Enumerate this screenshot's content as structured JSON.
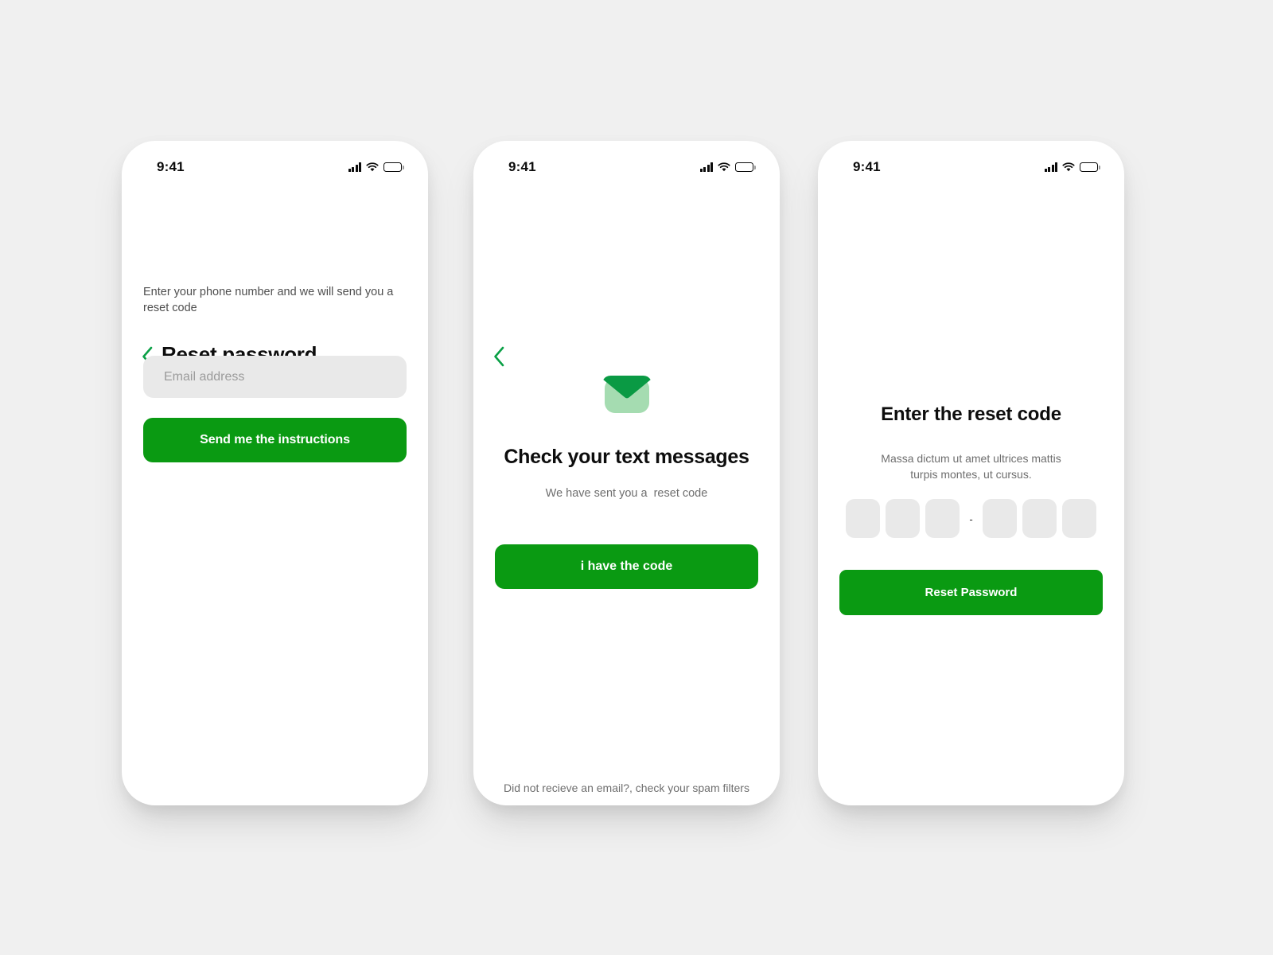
{
  "theme": {
    "page_background": "#f0f0f0",
    "card_background": "#ffffff",
    "accent_green": "#0a9a12",
    "envelope_light_green": "#a5dcb1",
    "input_gray": "#e9e9e9",
    "muted_text": "#6e6e6e",
    "title_text": "#0d0d0d"
  },
  "status_bar": {
    "time": "9:41",
    "signal_icon": "cellular-signal-icon",
    "wifi_icon": "wifi-icon",
    "battery_icon": "battery-full-icon"
  },
  "screens": [
    {
      "id": "reset-password",
      "back_icon": "chevron-left-icon",
      "title": "Reset password",
      "subtitle": "Enter your phone number and we will send you a reset code",
      "email_input": {
        "placeholder": "Email address",
        "value": ""
      },
      "primary_button": "Send me the instructions"
    },
    {
      "id": "check-messages",
      "back_icon": "chevron-left-icon",
      "illustration_icon": "envelope-icon",
      "title": "Check your text messages",
      "subtitle": "We have sent you a  reset code",
      "primary_button": "i have the code",
      "footer_note": "Did not recieve an email?, check your spam filters"
    },
    {
      "id": "enter-reset-code",
      "title": "Enter the reset code",
      "subtitle_line_1": "Massa dictum ut amet ultrices mattis",
      "subtitle_line_2": "turpis montes, ut cursus.",
      "code_boxes": [
        "",
        "",
        "",
        "",
        "",
        ""
      ],
      "code_separator": "-",
      "primary_button": "Reset Password"
    }
  ]
}
